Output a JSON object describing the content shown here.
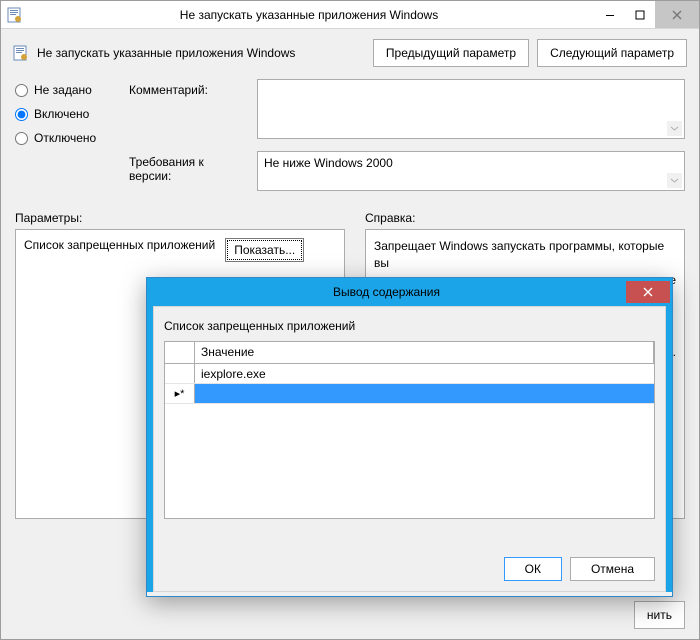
{
  "main": {
    "title": "Не запускать указанные приложения Windows",
    "header_label": "Не запускать указанные приложения Windows",
    "btn_prev": "Предыдущий параметр",
    "btn_next": "Следующий параметр",
    "radios": {
      "not_configured": "Не задано",
      "enabled": "Включено",
      "disabled": "Отключено",
      "selected": "enabled"
    },
    "labels": {
      "comment": "Комментарий:",
      "version": "Требования к версии:",
      "params": "Параметры:",
      "help": "Справка:",
      "param_caption": "Список запрещенных приложений",
      "btn_show": "Показать..."
    },
    "comment_value": "",
    "version_value": "Не ниже Windows 2000",
    "help_line_1": "Запрещает Windows запускать программы, которые вы",
    "help_line_2": "не",
    "help_line_3": "ы.",
    "footer_apply": "нить"
  },
  "modal": {
    "title": "Вывод содержания",
    "subtitle": "Список запрещенных приложений",
    "header_value": "Значение",
    "rows": [
      {
        "marker": "",
        "value": "iexplore.exe",
        "selected": false
      },
      {
        "marker": "▸*",
        "value": "",
        "selected": true
      }
    ],
    "btn_ok": "ОК",
    "btn_cancel": "Отмена"
  }
}
